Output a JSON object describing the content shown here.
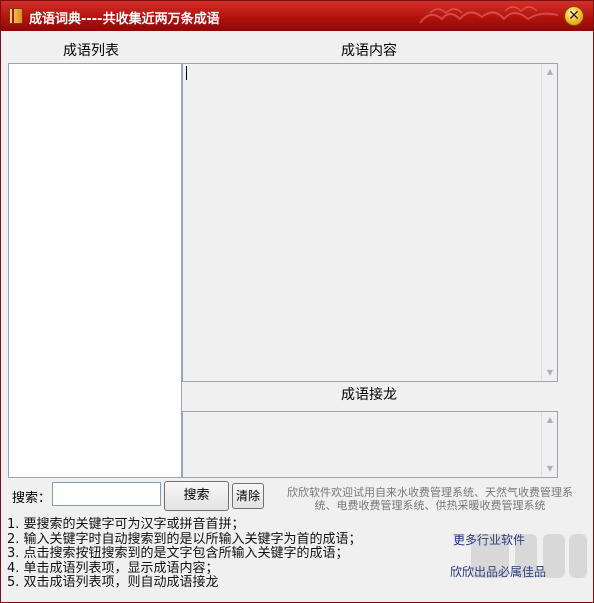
{
  "window": {
    "title": "成语词典----共收集近两万条成语",
    "close_glyph": "✕"
  },
  "list_panel": {
    "label": "成语列表",
    "items": []
  },
  "content_panel": {
    "label": "成语内容",
    "value": ""
  },
  "chain_panel": {
    "label": "成语接龙",
    "value": ""
  },
  "search": {
    "label": "搜索：",
    "value": "",
    "placeholder": "",
    "search_button": "搜索",
    "clear_button": "清除"
  },
  "promo_text": "欣欣软件欢迎试用自来水收费管理系统、天然气收费管理系统、电费收费管理系统、供热采暖收费管理系统",
  "instructions": [
    "1. 要搜索的关键字可为汉字或拼音首拼；",
    "2. 输入关键字时自动搜索到的是以所输入关键字为首的成语；",
    "3. 点击搜索按钮搜索到的是文字包含所输入关键字的成语；",
    "4. 单击成语列表项，显示成语内容；",
    "5. 双击成语列表项，则自动成语接龙"
  ],
  "links": {
    "more_software": "更多行业软件",
    "quality": "欣欣出品必属佳品"
  },
  "icons": {
    "app": "book-icon",
    "close": "close-icon",
    "scroll_up": "arrow-up-icon",
    "scroll_down": "arrow-down-icon"
  },
  "colors": {
    "titlebar": "#b3120e",
    "link": "#1a2f80",
    "close_button": "#f5c233"
  }
}
